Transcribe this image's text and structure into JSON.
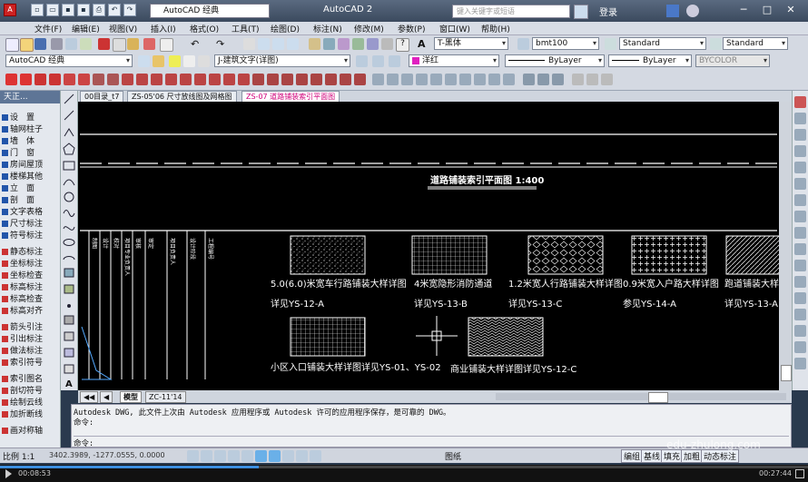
{
  "titlebar": {
    "workspace": "AutoCAD 经典",
    "app_title": "AutoCAD 2",
    "search_placeholder": "键入关键字或短语",
    "login": "登录"
  },
  "menu": [
    "文件(F)",
    "编辑(E)",
    "视图(V)",
    "插入(I)",
    "格式(O)",
    "工具(T)",
    "绘图(D)",
    "标注(N)",
    "修改(M)",
    "参数(P)",
    "窗口(W)",
    "帮助(H)"
  ],
  "toolbar1": {
    "text_style": "T-黑体",
    "dim_style": "bmt100",
    "table_style": "Standard",
    "multileader_style": "Standard"
  },
  "toolbar2": {
    "workspace": "AutoCAD 经典",
    "layer": "J-建筑文字(详图)",
    "color": "洋红",
    "linetype": "ByLayer",
    "lineweight": "ByLayer",
    "plotstyle": "BYCOLOR"
  },
  "palette": {
    "title": "天正...",
    "items": [
      "设　置",
      "轴网柱子",
      "墙　体",
      "门　窗",
      "房间屋顶",
      "楼梯其他",
      "立　面",
      "剖　面",
      "文字表格",
      "尺寸标注",
      "符号标注",
      "静态标注",
      "坐标标注",
      "坐标检查",
      "标高标注",
      "标高检查",
      "标高对齐",
      "箭头引注",
      "引出标注",
      "做法标注",
      "索引符号",
      "索引图名",
      "剖切符号",
      "绘制云线",
      "加折断线",
      "画对称轴"
    ]
  },
  "doc_tabs": [
    "00目录_t7",
    "ZS-05'06 尺寸放线图及网格图",
    "ZS-07  道路铺装索引平面图"
  ],
  "drawing": {
    "title": "道路铺装索引平面图  1:400",
    "titleblock": [
      "工程编号",
      "设计阶段",
      "项目负责人",
      "审定",
      "审核",
      "项目专业负责人",
      "校对",
      "设计",
      "制图"
    ],
    "notes": [
      "5.0(6.0)米宽车行路铺装大样详图",
      "详见YS-12-A",
      "4米宽隐形消防通道",
      "详见YS-13-B",
      "1.2米宽人行路铺装大样详图",
      "详见YS-13-C",
      "0.9米宽入户路大样详图",
      "参见YS-14-A",
      "跑道铺装大样详",
      "详见YS-13-A",
      "小区入口铺装大样详图详见YS-01、YS-02",
      "商业铺装大样详图详见YS-12-C"
    ]
  },
  "layout_tabs": [
    "模型",
    "ZC-11'14"
  ],
  "command": {
    "line1": "Autodesk DWG,  此文件上次由 Autodesk 应用程序或 Autodesk 许可的应用程序保存，是可靠的 DWG。",
    "line2": "命令:",
    "prompt": "命令:"
  },
  "status": {
    "scale": "比例 1:1",
    "coords": "3402.3989, -1277.0555, 0.0000",
    "mode1": "图纸",
    "buttons": [
      "编组",
      "基线",
      "填充",
      "加粗",
      "动态标注"
    ]
  },
  "watermark": "edu-zhulong.com",
  "player": {
    "current": "00:08:53",
    "total": "00:27:44",
    "progress": 0.32
  }
}
